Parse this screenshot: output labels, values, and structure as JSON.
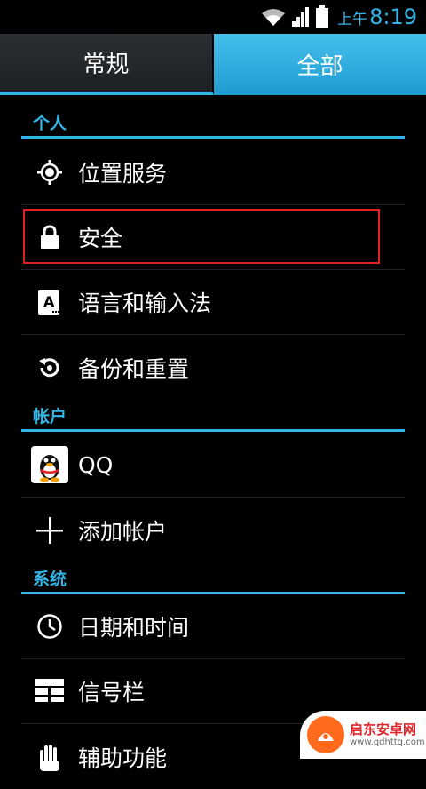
{
  "status_bar": {
    "ampm": "上午",
    "time": "8:19",
    "icons": [
      "wifi-icon",
      "signal-icon",
      "battery-icon"
    ],
    "accent": "#33b5e5"
  },
  "tabs": [
    {
      "label": "常规",
      "selected": false
    },
    {
      "label": "全部",
      "selected": true
    }
  ],
  "sections": {
    "personal": {
      "label": "个人",
      "items": [
        {
          "label": "位置服务",
          "icon": "location-icon"
        },
        {
          "label": "安全",
          "icon": "lock-icon"
        },
        {
          "label": "语言和输入法",
          "icon": "language-icon"
        },
        {
          "label": "备份和重置",
          "icon": "backup-restore-icon"
        }
      ]
    },
    "accounts": {
      "label": "帐户",
      "items": [
        {
          "label": "QQ",
          "icon": "qq-penguin-icon"
        },
        {
          "label": "添加帐户",
          "icon": "plus-icon"
        }
      ]
    },
    "system": {
      "label": "系统",
      "items": [
        {
          "label": "日期和时间",
          "icon": "clock-icon"
        },
        {
          "label": "信号栏",
          "icon": "signal-bar-icon"
        },
        {
          "label": "辅助功能",
          "icon": "hand-icon"
        }
      ]
    }
  },
  "highlight_color": "#e02020",
  "watermark": {
    "title": "启东安卓网",
    "url": "www.qdhttq.com"
  }
}
